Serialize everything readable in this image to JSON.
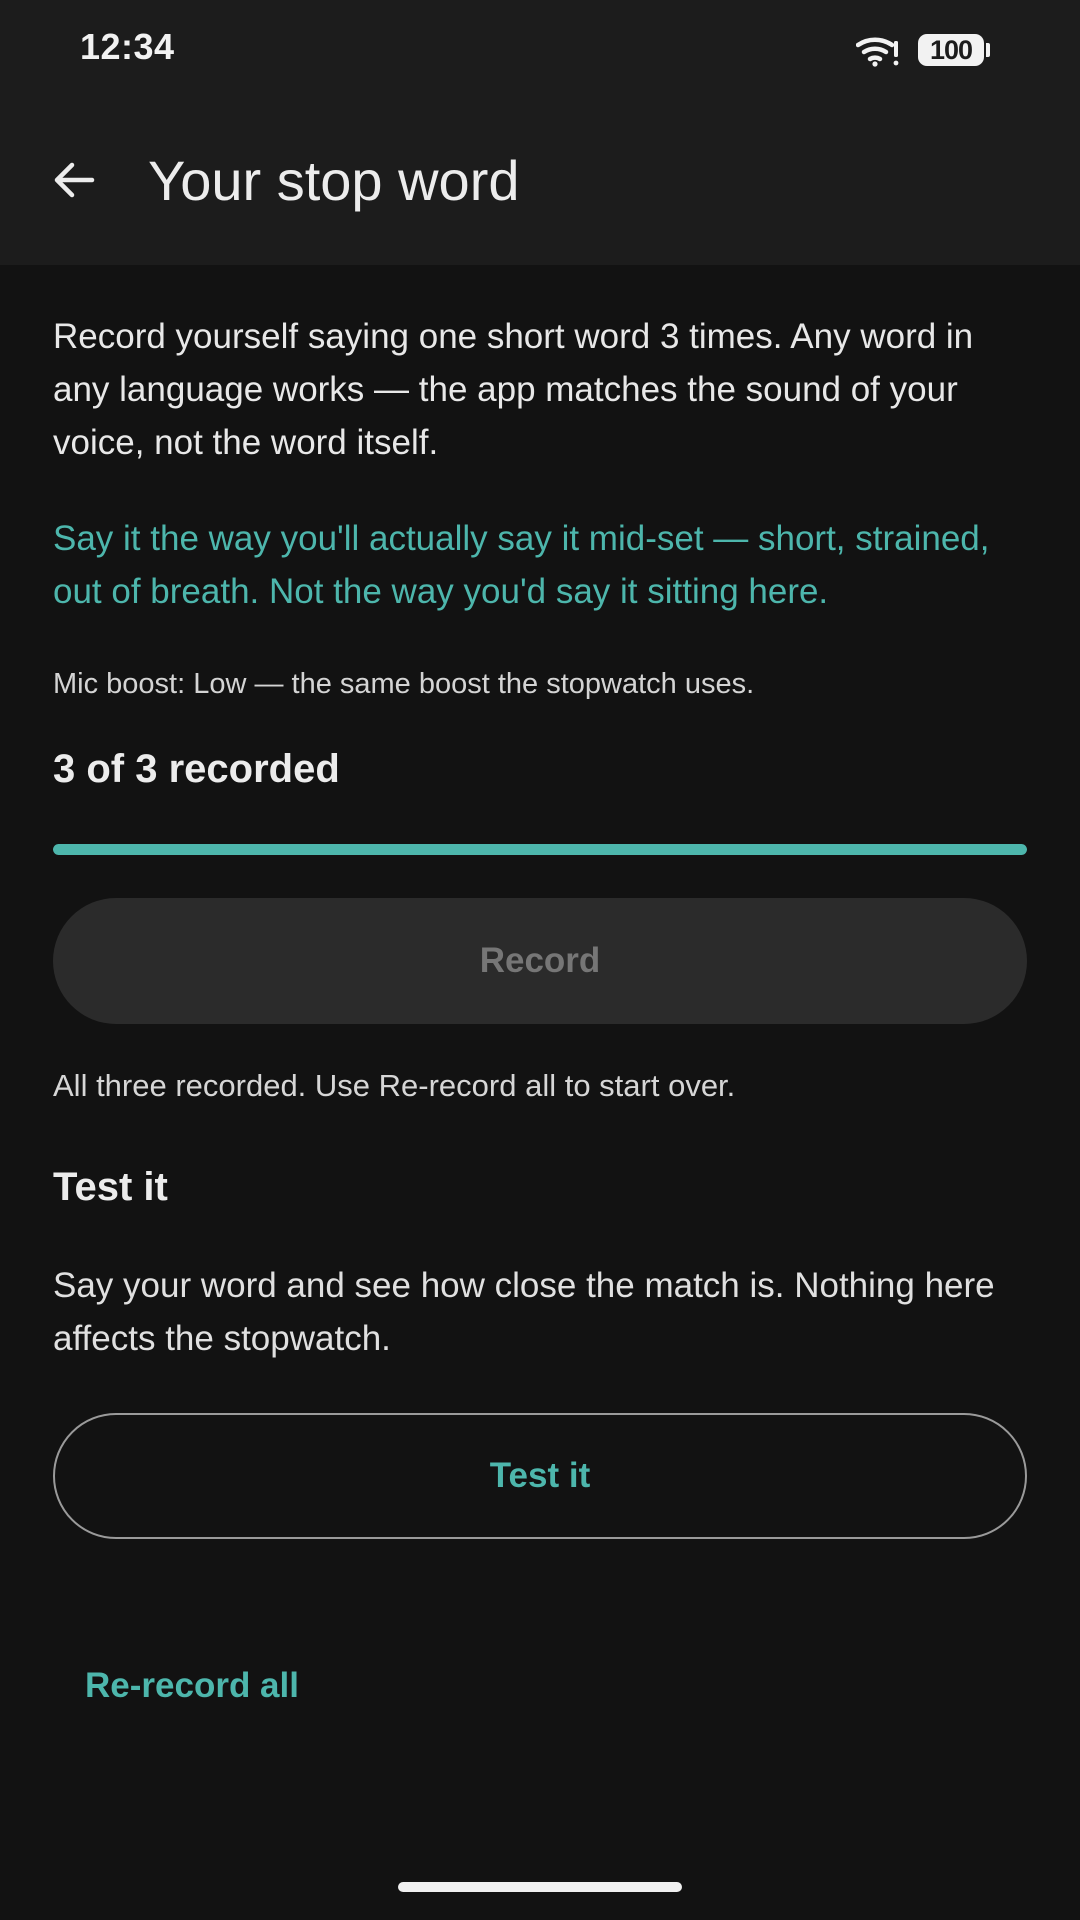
{
  "status_bar": {
    "time": "12:34",
    "battery_level": "100",
    "icons": [
      "wifi-icon",
      "battery-icon"
    ]
  },
  "app_bar": {
    "back_icon": "arrow-back-icon",
    "title": "Your stop word"
  },
  "main": {
    "intro": "Record yourself saying one short word 3 times. Any word in any language works — the app matches the sound of your voice, not the word itself.",
    "tip": "Say it the way you'll actually say it mid-set — short, strained, out of breath. Not the way you'd say it sitting here.",
    "mic_boost": "Mic boost: Low — the same boost the stopwatch uses.",
    "progress": {
      "label": "3 of 3 recorded",
      "recorded": 3,
      "total": 3,
      "fraction": 1.0
    },
    "record_button": "Record",
    "record_hint": "All three recorded. Use Re-record all to start over.",
    "test_section": {
      "heading": "Test it",
      "body": "Say your word and see how close the match is. Nothing here affects the stopwatch.",
      "button": "Test it"
    },
    "rerecord_link": "Re-record all"
  },
  "colors": {
    "background": "#121212",
    "app_bar": "#1c1c1c",
    "accent": "#4db6ac",
    "disabled_button": "#2b2b2b",
    "disabled_text": "#767676"
  }
}
